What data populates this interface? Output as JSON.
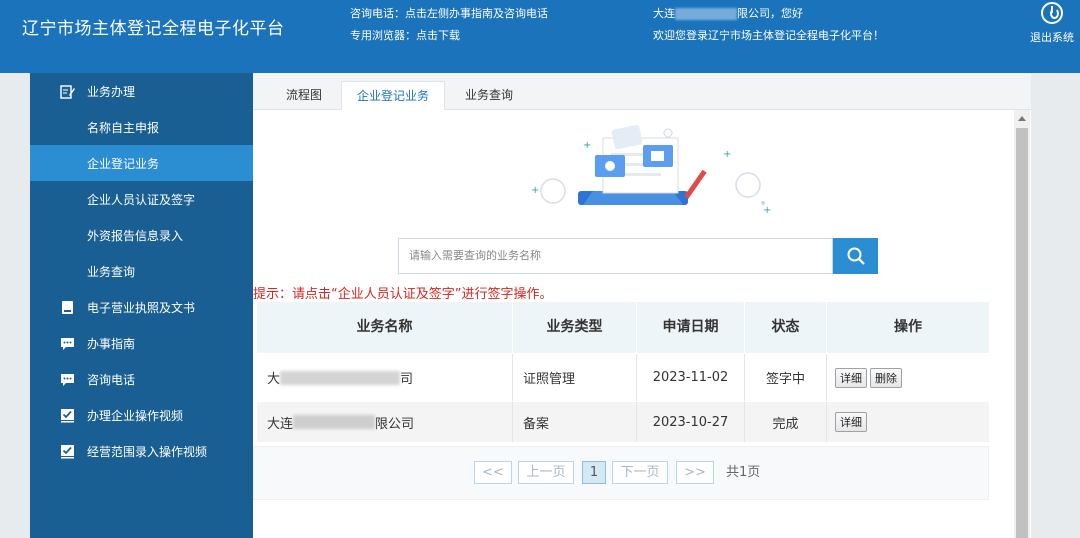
{
  "header": {
    "brand": "辽宁市场主体登记全程电子化平台",
    "hotline": "咨询电话：点击左侧办事指南及咨询电话",
    "browser": "专用浏览器：点击下载",
    "welcome_prefix": "大连",
    "welcome_suffix": "限公司，您好",
    "welcome_line2": "欢迎您登录辽宁市场主体登记全程电子化平台！",
    "logout_label": "退出系统"
  },
  "sidebar": {
    "items": [
      {
        "label": "业务办理",
        "icon": "edit-icon"
      },
      {
        "label": "名称自主申报"
      },
      {
        "label": "企业登记业务"
      },
      {
        "label": "企业人员认证及签字"
      },
      {
        "label": "外资报告信息录入"
      },
      {
        "label": "业务查询"
      },
      {
        "label": "电子营业执照及文书",
        "icon": "book-icon"
      },
      {
        "label": "办事指南",
        "icon": "chat-icon"
      },
      {
        "label": "咨询电话",
        "icon": "chat-icon"
      },
      {
        "label": "办理企业操作视频",
        "icon": "check-icon"
      },
      {
        "label": "经营范围录入操作视频",
        "icon": "check-icon"
      }
    ]
  },
  "tabs": [
    "流程图",
    "企业登记业务",
    "业务查询"
  ],
  "search": {
    "placeholder": "请输入需要查询的业务名称"
  },
  "hint": "提示：请点击“企业人员认证及签字”进行签字操作。",
  "table": {
    "headers": [
      "业务名称",
      "业务类型",
      "申请日期",
      "状态",
      "操作"
    ],
    "rows": [
      {
        "name_prefix": "大",
        "name_suffix": "司",
        "type": "证照管理",
        "date": "2023-11-02",
        "status": "签字中",
        "actions": [
          "详细",
          "删除"
        ]
      },
      {
        "name_prefix": "大连",
        "name_suffix": "限公司",
        "type": "备案",
        "date": "2023-10-27",
        "status": "完成",
        "actions": [
          "详细"
        ]
      }
    ]
  },
  "pager": {
    "first": "<<",
    "prev": "上一页",
    "current": "1",
    "next": "下一页",
    "last": ">>",
    "total": "共1页"
  },
  "colors": {
    "header": "#1b74bb",
    "sidebar": "#1a5f94",
    "active": "#2b8ed3",
    "hint": "#d9251d"
  }
}
